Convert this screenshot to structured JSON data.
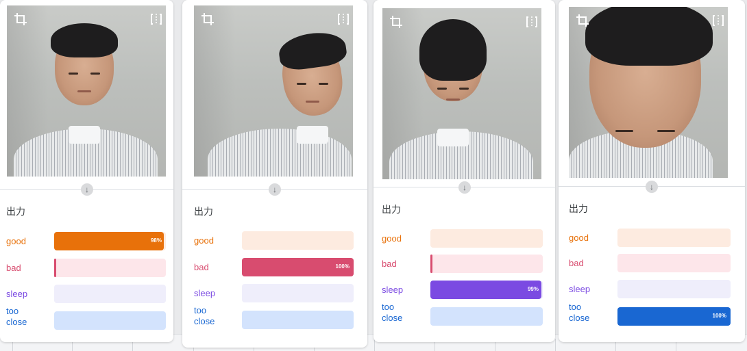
{
  "output_label": "出力",
  "classes": [
    {
      "key": "good",
      "label": "good",
      "color": "#e8710a",
      "track": "#fdebe0"
    },
    {
      "key": "bad",
      "label": "bad",
      "color": "#d84c6f",
      "track": "#fde6ea"
    },
    {
      "key": "sleep",
      "label": "sleep",
      "color": "#7b4ae2",
      "track": "#efeefb"
    },
    {
      "key": "close",
      "label": "too close",
      "label_lines": [
        "too",
        "close"
      ],
      "color": "#1967d2",
      "track": "#d3e3fd"
    }
  ],
  "panels": [
    {
      "name": "panel-1",
      "icons": [
        "crop-icon",
        "flip-icon",
        "arrow-down-icon"
      ],
      "values": {
        "good": 0.98,
        "bad": 0.01,
        "sleep": 0.0,
        "close": 0.0
      },
      "pct_text": {
        "good": "98%"
      }
    },
    {
      "name": "panel-2",
      "icons": [
        "crop-icon",
        "flip-icon",
        "arrow-down-icon"
      ],
      "values": {
        "good": 0.0,
        "bad": 1.0,
        "sleep": 0.0,
        "close": 0.0
      },
      "pct_text": {
        "bad": "100%"
      }
    },
    {
      "name": "panel-3",
      "icons": [
        "crop-icon",
        "flip-icon",
        "arrow-down-icon"
      ],
      "values": {
        "good": 0.0,
        "bad": 0.01,
        "sleep": 0.99,
        "close": 0.0
      },
      "pct_text": {
        "sleep": "99%"
      }
    },
    {
      "name": "panel-4",
      "icons": [
        "crop-icon",
        "flip-icon",
        "arrow-down-icon"
      ],
      "values": {
        "good": 0.0,
        "bad": 0.0,
        "sleep": 0.0,
        "close": 1.0
      },
      "pct_text": {
        "close": "100%"
      }
    }
  ]
}
